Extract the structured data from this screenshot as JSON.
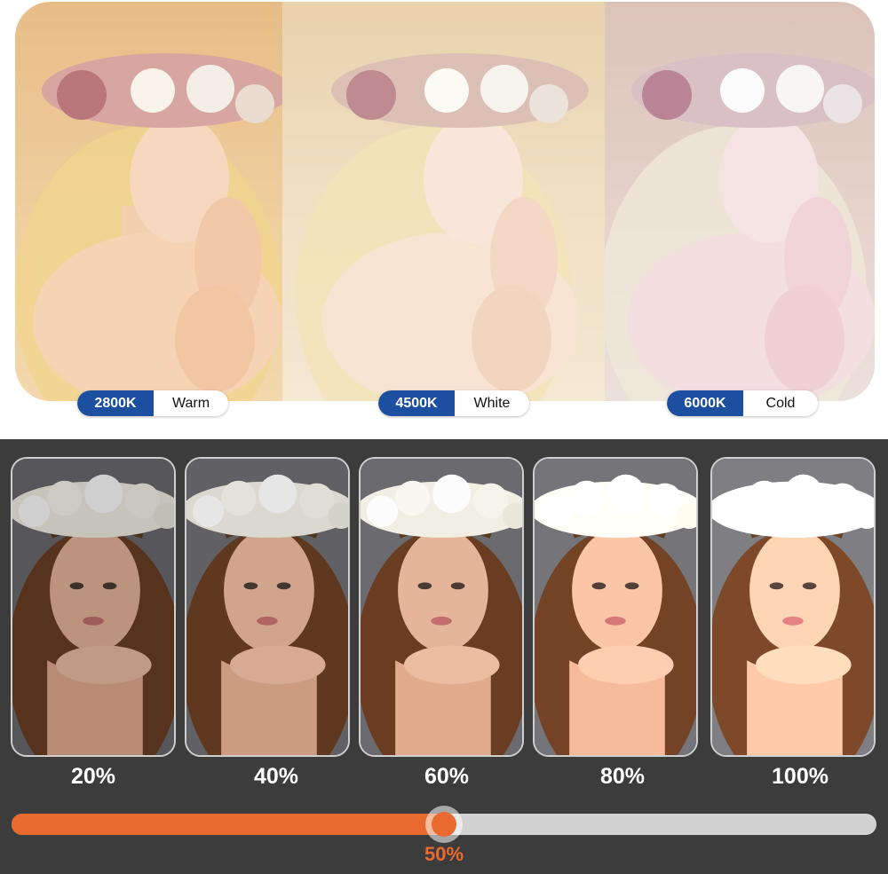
{
  "temperature_modes": [
    {
      "kelvin": "2800K",
      "name": "Warm",
      "tone": "#f0cfa0"
    },
    {
      "kelvin": "4500K",
      "name": "White",
      "tone": "#f1e2c7"
    },
    {
      "kelvin": "6000K",
      "name": "Cold",
      "tone": "#e6d4cd"
    }
  ],
  "brightness_levels": [
    {
      "label": "20%",
      "level": 0.2
    },
    {
      "label": "40%",
      "level": 0.4
    },
    {
      "label": "60%",
      "level": 0.6
    },
    {
      "label": "80%",
      "level": 0.8
    },
    {
      "label": "100%",
      "level": 1.0
    }
  ],
  "slider": {
    "value_label": "50%",
    "value": 0.5
  },
  "colors": {
    "kelvin_badge": "#1d4fa0",
    "accent": "#e96a2e",
    "track": "#d2d2d2",
    "dark_background": "#3c3c3c"
  }
}
